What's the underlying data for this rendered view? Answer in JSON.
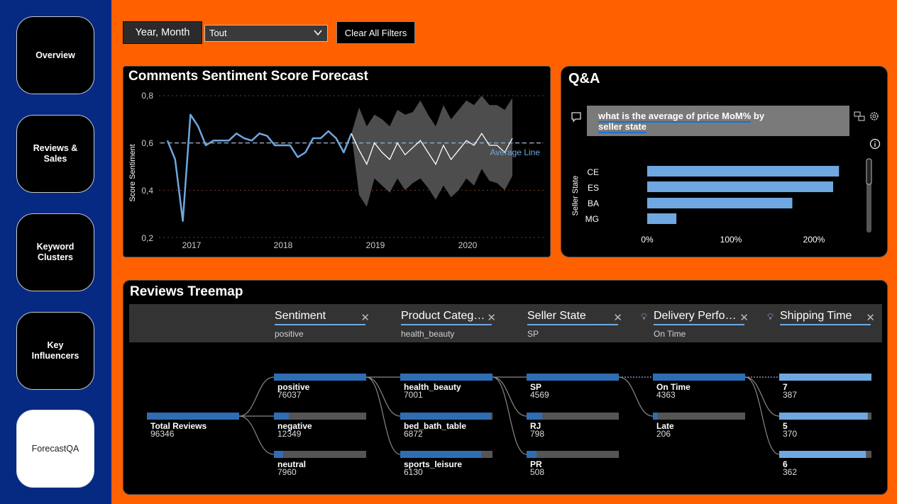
{
  "nav": {
    "items": [
      {
        "label": "Overview",
        "active": false
      },
      {
        "label": "Reviews &\nSales",
        "active": false
      },
      {
        "label": "Keyword\nClusters",
        "active": false
      },
      {
        "label": "Key\nInfluencers",
        "active": false
      },
      {
        "label": "ForecastQA",
        "active": true
      }
    ]
  },
  "filters": {
    "field_label": "Year, Month",
    "selected_value": "Tout",
    "clear_label": "Clear All Filters"
  },
  "forecast": {
    "title": "Comments Sentiment Score Forecast",
    "ylabel": "Score Sentiment",
    "y_ticks": [
      "0,8",
      "0,6",
      "0,4",
      "0,2"
    ],
    "x_ticks": [
      "2017",
      "2018",
      "2019",
      "2020"
    ],
    "avg_label": "Average Line"
  },
  "chart_data": {
    "type": "line",
    "title": "Comments Sentiment Score Forecast",
    "ylabel": "Score Sentiment",
    "ylim": [
      0.2,
      0.8
    ],
    "x_start": "2016-10",
    "x_step": "month",
    "average": 0.6,
    "series": [
      {
        "name": "actual",
        "values": [
          0.61,
          0.53,
          0.27,
          0.72,
          0.67,
          0.59,
          0.61,
          0.61,
          0.61,
          0.64,
          0.62,
          0.61,
          0.64,
          0.63,
          0.59,
          0.59,
          0.59,
          0.54,
          0.56,
          0.62,
          0.62,
          0.65,
          0.62,
          0.56,
          0.64
        ]
      },
      {
        "name": "forecast",
        "values": [
          0.64,
          0.57,
          0.51,
          0.6,
          0.56,
          0.53,
          0.6,
          0.55,
          0.58,
          0.61,
          0.56,
          0.51,
          0.59,
          0.53,
          0.57,
          0.61,
          0.59,
          0.64,
          0.59,
          0.59,
          0.56,
          0.62
        ]
      },
      {
        "name": "forecast_upper",
        "values": [
          0.64,
          0.75,
          0.67,
          0.72,
          0.7,
          0.67,
          0.74,
          0.72,
          0.73,
          0.78,
          0.72,
          0.67,
          0.76,
          0.7,
          0.74,
          0.78,
          0.76,
          0.8,
          0.76,
          0.76,
          0.74,
          0.79
        ]
      },
      {
        "name": "forecast_lower",
        "values": [
          0.64,
          0.38,
          0.33,
          0.45,
          0.42,
          0.39,
          0.45,
          0.4,
          0.43,
          0.45,
          0.41,
          0.36,
          0.42,
          0.37,
          0.4,
          0.45,
          0.42,
          0.49,
          0.44,
          0.43,
          0.4,
          0.46
        ]
      }
    ],
    "forecast_start_index": 24
  },
  "qa": {
    "title": "Q&A",
    "query_part1": "what is the average of price MoM%",
    "query_part2": " by",
    "query_part3": "seller state",
    "ylabel": "Seller State",
    "categories": [
      "CE",
      "ES",
      "BA",
      "MG"
    ],
    "values": [
      230,
      223,
      174,
      35
    ],
    "x_ticks": [
      "0%",
      "100%",
      "200%"
    ],
    "xlim": [
      0,
      250
    ]
  },
  "treemap": {
    "title": "Reviews Treemap",
    "levels": [
      {
        "name": "Sentiment",
        "value": "positive",
        "bulb": false
      },
      {
        "name": "Product Categ…",
        "value": "health_beauty",
        "bulb": false
      },
      {
        "name": "Seller State",
        "value": "SP",
        "bulb": false
      },
      {
        "name": "Delivery Perfo…",
        "value": "On Time",
        "bulb": true
      },
      {
        "name": "Shipping Time",
        "value": "",
        "bulb": true
      }
    ],
    "root": {
      "label": "Total Reviews",
      "count": "96346",
      "value": 96346
    },
    "columns": [
      [
        {
          "label": "positive",
          "count": "76037",
          "value": 76037,
          "frac": 1.0
        },
        {
          "label": "negative",
          "count": "12349",
          "value": 12349,
          "frac": 0.16
        },
        {
          "label": "neutral",
          "count": "7960",
          "value": 7960,
          "frac": 0.1
        }
      ],
      [
        {
          "label": "health_beauty",
          "count": "7001",
          "value": 7001,
          "frac": 1.0
        },
        {
          "label": "bed_bath_table",
          "count": "6872",
          "value": 6872,
          "frac": 0.98
        },
        {
          "label": "sports_leisure",
          "count": "6130",
          "value": 6130,
          "frac": 0.88
        }
      ],
      [
        {
          "label": "SP",
          "count": "4569",
          "value": 4569,
          "frac": 1.0
        },
        {
          "label": "RJ",
          "count": "798",
          "value": 798,
          "frac": 0.17
        },
        {
          "label": "PR",
          "count": "508",
          "value": 508,
          "frac": 0.11
        }
      ],
      [
        {
          "label": "On Time",
          "count": "4363",
          "value": 4363,
          "frac": 1.0
        },
        {
          "label": "Late",
          "count": "206",
          "value": 206,
          "frac": 0.05
        }
      ],
      [
        {
          "label": "7",
          "count": "387",
          "value": 387,
          "frac": 1.0
        },
        {
          "label": "5",
          "count": "370",
          "value": 370,
          "frac": 0.96
        },
        {
          "label": "6",
          "count": "362",
          "value": 362,
          "frac": 0.94
        }
      ]
    ]
  }
}
